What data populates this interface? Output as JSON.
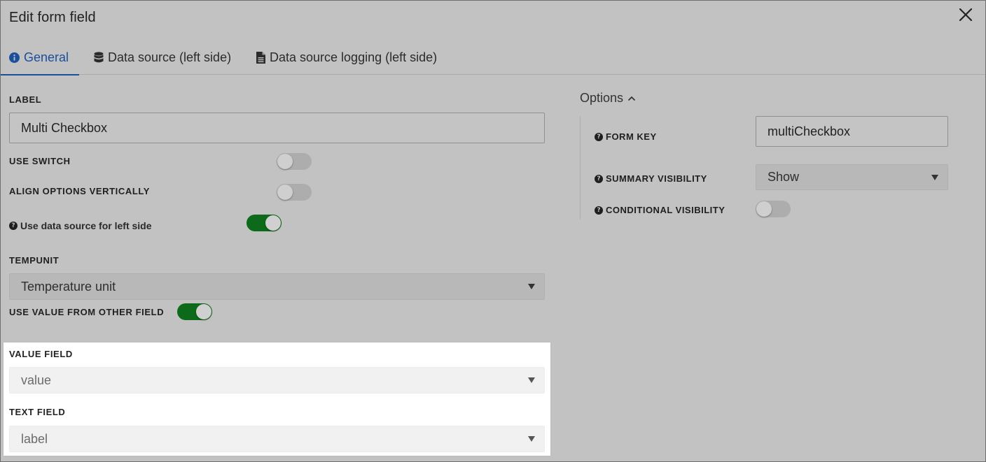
{
  "dialog": {
    "title": "Edit form field",
    "close_icon": "close-icon"
  },
  "tabs": [
    {
      "label": "General",
      "icon": "info-circle-icon",
      "active": true
    },
    {
      "label": "Data source (left side)",
      "icon": "database-icon",
      "active": false
    },
    {
      "label": "Data source logging (left side)",
      "icon": "file-text-icon",
      "active": false
    }
  ],
  "left": {
    "label_title": "LABEL",
    "label_value": "Multi Checkbox",
    "use_switch": {
      "label": "USE SWITCH",
      "on": false
    },
    "align_vertical": {
      "label": "ALIGN OPTIONS VERTICALLY",
      "on": false
    },
    "use_data_source": {
      "label": "Use data source for left side",
      "on": true
    },
    "tempunit": {
      "label": "TEMPUNIT",
      "value": "Temperature unit"
    },
    "use_value_other": {
      "label": "USE VALUE FROM OTHER FIELD",
      "on": true
    },
    "value_field": {
      "label": "VALUE FIELD",
      "value": "value"
    },
    "text_field": {
      "label": "TEXT FIELD",
      "value": "label"
    }
  },
  "options": {
    "title": "Options",
    "form_key": {
      "label": "FORM KEY",
      "value": "multiCheckbox"
    },
    "summary_visibility": {
      "label": "SUMMARY VISIBILITY",
      "value": "Show"
    },
    "conditional_visibility": {
      "label": "CONDITIONAL VISIBILITY",
      "on": false
    }
  },
  "colors": {
    "accent": "#1b4e9c",
    "toggle_on": "#0c6a1a",
    "backdrop": "#c2c2c2"
  }
}
